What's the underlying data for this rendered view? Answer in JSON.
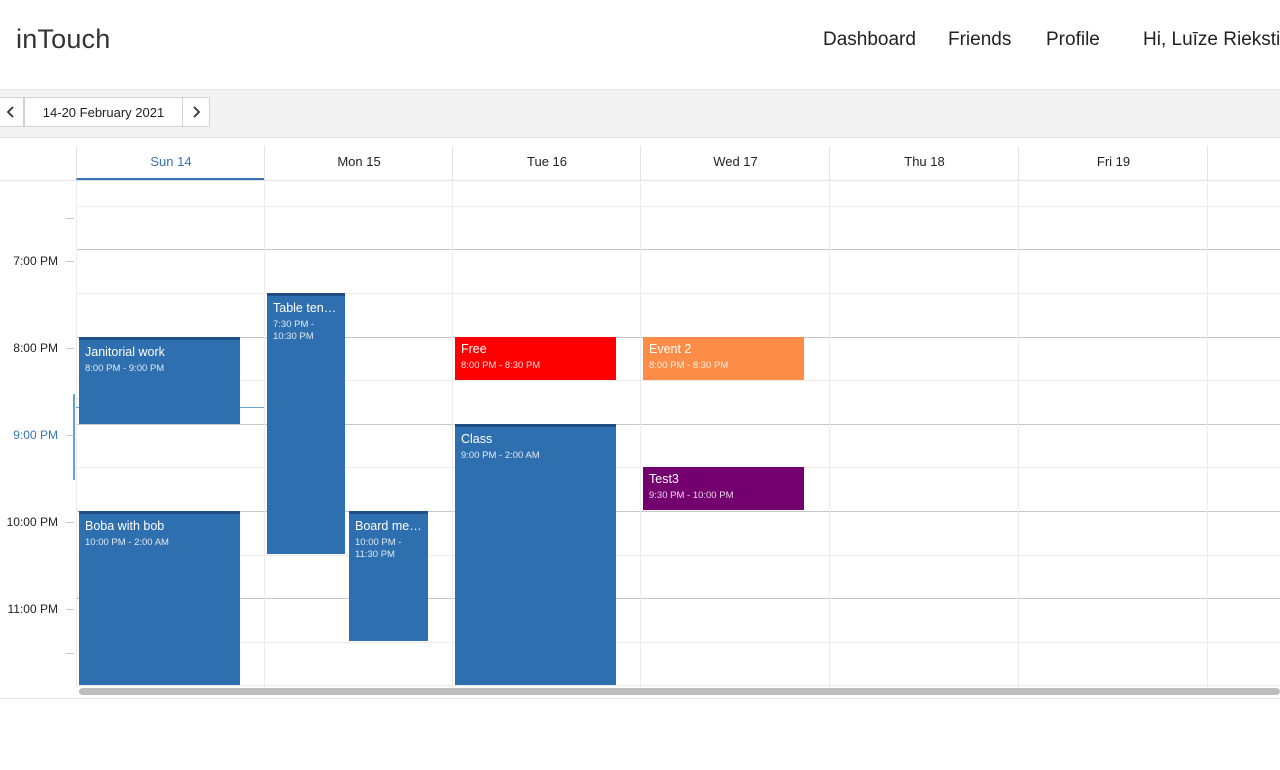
{
  "app": {
    "logo": "inTouch"
  },
  "nav": {
    "dashboard": "Dashboard",
    "friends": "Friends",
    "profile": "Profile",
    "greeting": "Hi, Luīze Riekstiņa"
  },
  "toolbar": {
    "prev_icon": "chevron-left-icon",
    "next_icon": "chevron-right-icon",
    "date_range": "14-20 February 2021"
  },
  "days": [
    "Sun 14",
    "Mon 15",
    "Tue 16",
    "Wed 17",
    "Thu 18",
    "Fri 19"
  ],
  "selected_day": "Sun 14",
  "times": [
    "7:00 PM",
    "8:00 PM",
    "9:00 PM",
    "10:00 PM",
    "11:00 PM"
  ],
  "current_time_label": "9:00 PM",
  "colors": {
    "accent": "#3674b8",
    "event_blue": "#2e6fb0",
    "event_red": "#ff0000",
    "event_orange": "#fd8c47",
    "event_purple": "#73006e"
  },
  "events": [
    {
      "title": "Janitorial work",
      "time": "8:00 PM - 9:00 PM"
    },
    {
      "title": "Table tennis",
      "time": "7:30 PM - 10:30 PM"
    },
    {
      "title": "Free",
      "time": "8:00 PM - 8:30 PM"
    },
    {
      "title": "Event 2",
      "time": "8:00 PM - 8:30 PM"
    },
    {
      "title": "Class",
      "time": "9:00 PM - 2:00 AM"
    },
    {
      "title": "Test3",
      "time": "9:30 PM - 10:00 PM"
    },
    {
      "title": "Boba with bob",
      "time": "10:00 PM - 2:00 AM"
    },
    {
      "title": "Board meeting",
      "time": "10:00 PM - 11:30 PM"
    }
  ]
}
